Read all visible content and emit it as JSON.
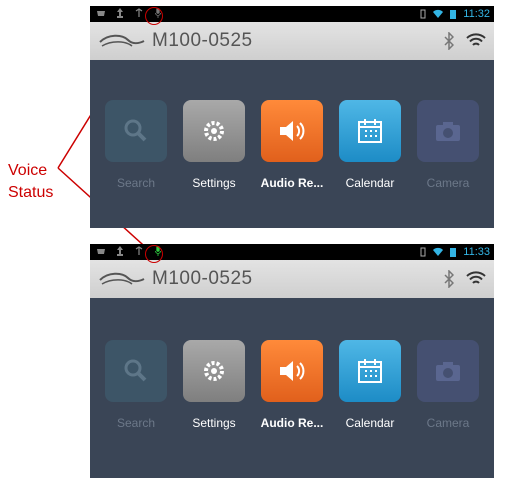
{
  "annotation": {
    "label_line1": "Voice",
    "label_line2": "Status",
    "color": "#cc0000"
  },
  "screens": [
    {
      "status": {
        "time": "11:32",
        "mic_color": "#777777"
      },
      "title": {
        "device_name": "M100-0525"
      },
      "apps": [
        {
          "label": "Search",
          "icon": "search-icon",
          "enabled": false
        },
        {
          "label": "Settings",
          "icon": "gear-icon",
          "enabled": true
        },
        {
          "label": "Audio Re...",
          "icon": "speaker-icon",
          "enabled": true
        },
        {
          "label": "Calendar",
          "icon": "calendar-icon",
          "enabled": true
        },
        {
          "label": "Camera",
          "icon": "camera-icon",
          "enabled": false
        }
      ]
    },
    {
      "status": {
        "time": "11:33",
        "mic_color": "#2ecc40"
      },
      "title": {
        "device_name": "M100-0525"
      },
      "apps": [
        {
          "label": "Search",
          "icon": "search-icon",
          "enabled": false
        },
        {
          "label": "Settings",
          "icon": "gear-icon",
          "enabled": true
        },
        {
          "label": "Audio Re...",
          "icon": "speaker-icon",
          "enabled": true
        },
        {
          "label": "Calendar",
          "icon": "calendar-icon",
          "enabled": true
        },
        {
          "label": "Camera",
          "icon": "camera-icon",
          "enabled": false
        }
      ]
    }
  ],
  "colors": {
    "screen_bg": "#3a4556",
    "status_accent": "#33b5e5",
    "audio_orange": "#f07a2a",
    "calendar_blue": "#33a4da"
  }
}
